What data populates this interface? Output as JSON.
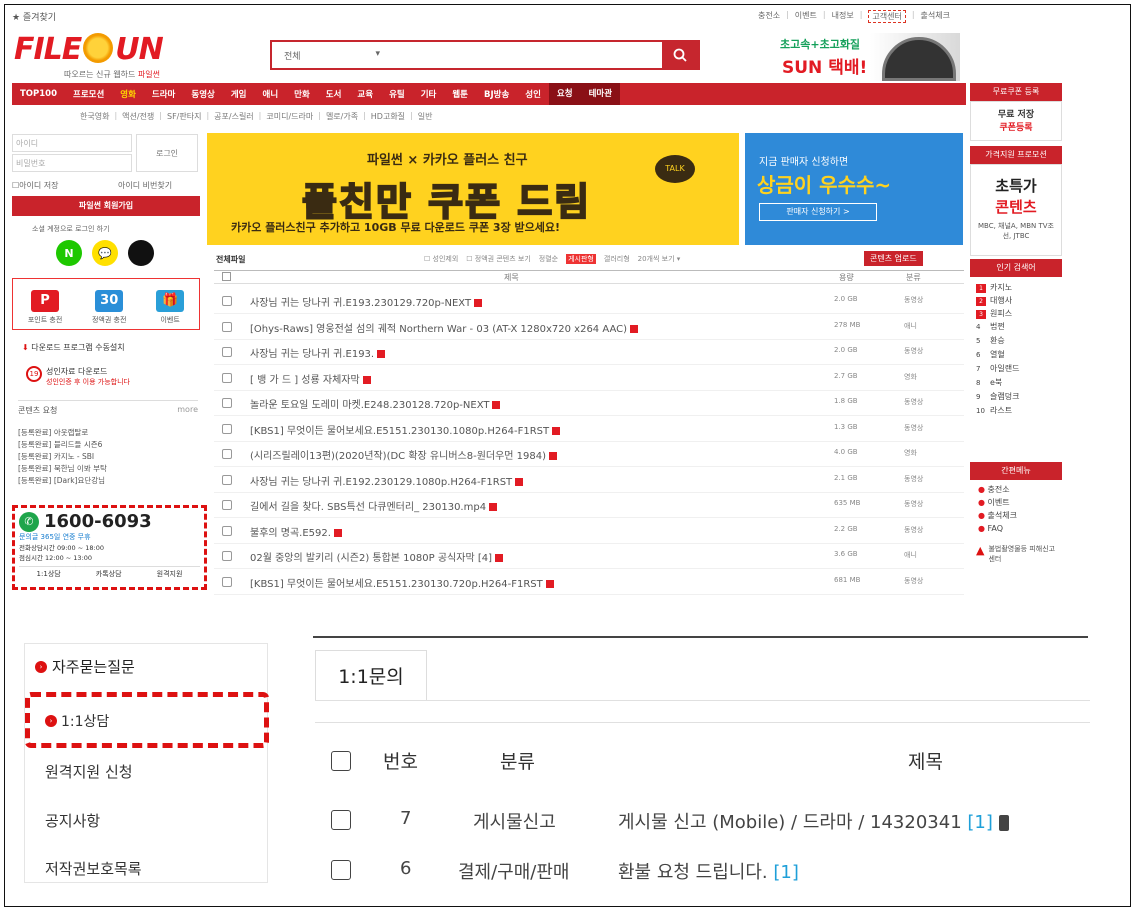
{
  "top": {
    "favorite": "★ 즐겨찾기",
    "links": [
      "충전소",
      "이벤트",
      "내정보",
      "고객센터",
      "출석체크"
    ]
  },
  "logo": {
    "left": "FILE",
    "right": "UN",
    "slogan_a": "따오르는 신규 웹하드",
    "slogan_b": "파일썬"
  },
  "search": {
    "category": "전체",
    "button_icon": "search-icon"
  },
  "promo": {
    "line1": "초고속+초고화질",
    "line2": "SUN 택배!"
  },
  "nav": {
    "items": [
      "TOP100",
      "프로모션",
      "영화",
      "드라마",
      "동영상",
      "게임",
      "애니",
      "만화",
      "도서",
      "교육",
      "유틸",
      "기타",
      "웹툰",
      "BJ방송",
      "성인",
      "요청",
      "테마관"
    ],
    "active": "영화"
  },
  "subnav": [
    "한국영화",
    "액션/전쟁",
    "SF/판타지",
    "공포/스릴러",
    "코미디/드라마",
    "멜로/가족",
    "HD고화질",
    "일반"
  ],
  "login": {
    "id_placeholder": "아이디",
    "pw_placeholder": "비밀번호",
    "login_button": "로그인",
    "save_id": "아이디 저장",
    "find": "아이디 비번찾기",
    "join": "파일썬 회원가입",
    "sns_label": "소셜 계정으로 로그인 하기",
    "sns": [
      "N",
      "💬",
      ""
    ]
  },
  "coupons": [
    {
      "label": "포인트 충전",
      "icon": "P",
      "color": "#e21b23"
    },
    {
      "label": "정액권 충전",
      "icon": "30",
      "color": "#2a8fd8"
    },
    {
      "label": "이벤트",
      "icon": "🎁",
      "color": "#2a9fd8"
    }
  ],
  "sidebar_links": {
    "install": "다운로드 프로그램 수동설치",
    "adult_a": "성인자료 다운로드",
    "adult_b": "성인인증 후 이용 가능합니다",
    "request_title": "콘텐츠 요청",
    "more": "more",
    "requests": [
      "[등록완료] 아웃랩탈로",
      "[등록완료] 블리드들 시즌6",
      "[등록완료] 카지노 - SBI",
      "[등록완료] 북한님 이봐 부탁",
      "[등록완료] [Dark]요단강님"
    ]
  },
  "cs": {
    "phone": "1600-6093",
    "sub": "문의글 365일 연중 무휴",
    "hours1": "전화상담시간 09:00 ~ 18:00",
    "hours2": "점심시간 12:00 ~ 13:00",
    "links": [
      "1:1상담",
      "카톡상담",
      "원격지원"
    ]
  },
  "hero": {
    "a": "파일썬 × 카카오 플러스 친구",
    "b": "플친만 쿠폰 드림",
    "c": "카카오 플러스친구 추가하고 10GB 무료 다운로드 쿠폰 3장 받으세요!",
    "talk": "TALK"
  },
  "hero2": {
    "a": "지금 판매자 신청하면",
    "b": "상금이 우수수~",
    "c": "판매자 신청하기 >"
  },
  "list": {
    "title": "전체파일",
    "filters": [
      "성인제외",
      "정액권 콘텐츠 보기",
      "정렬순",
      "게시판형",
      "갤러리형",
      "20개씩 보기 ▾"
    ],
    "upload": "콘텐츠 업로드",
    "col_title": "제목",
    "col_size": "용량",
    "col_cat": "분류",
    "rows": [
      {
        "title": "사장님 귀는 당나귀 귀.E193.230129.720p-NEXT",
        "size": "2.0 GB",
        "cat": "동영상"
      },
      {
        "title": "[Ohys-Raws] 영웅전설 섬의 궤적 Northern War - 03 (AT-X 1280x720 x264 AAC)",
        "size": "278 MB",
        "cat": "애니"
      },
      {
        "title": "사장님 귀는 당나귀 귀.E193.",
        "size": "2.0 GB",
        "cat": "동영상"
      },
      {
        "title": "[ 뱅 가 드 ] 성룡 자체자막",
        "size": "2.7 GB",
        "cat": "영화"
      },
      {
        "title": "놀라운 토요일 도레미 마켓.E248.230128.720p-NEXT",
        "size": "1.8 GB",
        "cat": "동영상"
      },
      {
        "title": "[KBS1] 무엇이든 물어보세요.E5151.230130.1080p.H264-F1RST",
        "size": "1.3 GB",
        "cat": "동영상"
      },
      {
        "title": "(시리즈릴레이13편)(2020년작)(DC 확장 유니버스8-원더우먼 1984)",
        "size": "4.0 GB",
        "cat": "영화"
      },
      {
        "title": "사장님 귀는 당나귀 귀.E192.230129.1080p.H264-F1RST",
        "size": "2.1 GB",
        "cat": "동영상"
      },
      {
        "title": "길에서 길을 찾다. SBS특선 다큐멘터리_ 230130.mp4",
        "size": "635 MB",
        "cat": "동영상"
      },
      {
        "title": "불후의 명곡.E592.",
        "size": "2.2 GB",
        "cat": "동영상"
      },
      {
        "title": "02월 중앙의 발키리 (시즌2) 통합본 1080P 공식자막 [4]",
        "size": "3.6 GB",
        "cat": "애니"
      },
      {
        "title": "[KBS1] 무엇이든 물어보세요.E5151.230130.720p.H264-F1RST",
        "size": "681 MB",
        "cat": "동영상"
      }
    ]
  },
  "right": {
    "coupon_head": "무료쿠폰 등록",
    "coupon_a": "무료 저장",
    "coupon_b": "쿠폰등록",
    "promo_head": "가격지원 프로모션",
    "promo_a": "초특가",
    "promo_b": "콘텐츠",
    "promo_c": "MBC, 채널A, MBN TV조선, JTBC",
    "hot_head": "인기 검색어",
    "hot": [
      "카지노",
      "대행사",
      "원피스",
      "법쩐",
      "환승",
      "열혈",
      "아일랜드",
      "e북",
      "슬램덩크",
      "라스트"
    ],
    "menu_head": "간편메뉴",
    "menu": [
      "충전소",
      "이벤트",
      "출석체크",
      "FAQ"
    ],
    "report": "불법촬영물등 피해신고센터"
  },
  "faq": {
    "title": "자주묻는질문",
    "items": [
      "1:1상담",
      "원격지원 신청",
      "공지사항",
      "저작권보호목록"
    ]
  },
  "inquiry": {
    "tab": "1:1문의",
    "headers": {
      "num": "번호",
      "cat": "분류",
      "title": "제목"
    },
    "rows": [
      {
        "num": "7",
        "cat": "게시물신고",
        "title": "게시물 신고 (Mobile) / 드라마 / 14320341",
        "count": "[1]"
      },
      {
        "num": "6",
        "cat": "결제/구매/판매",
        "title": "환불 요청 드립니다.",
        "count": "[1]"
      }
    ]
  }
}
